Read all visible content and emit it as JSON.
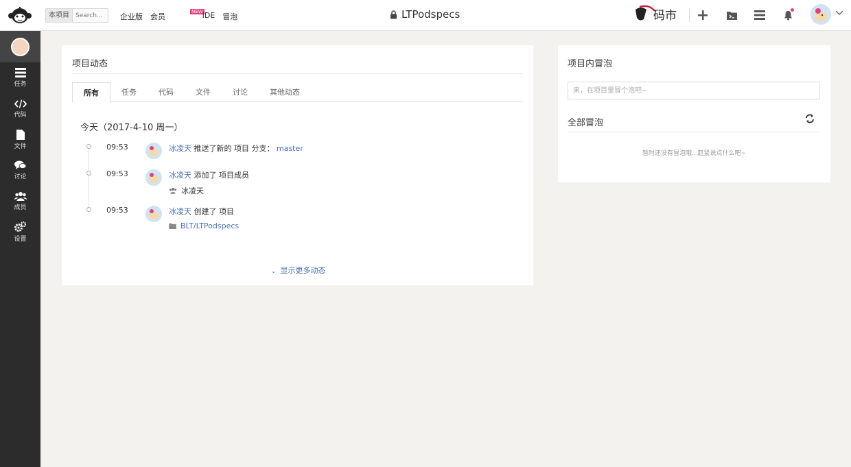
{
  "topbar": {
    "search_scope": "本项目",
    "search_placeholder": "Search...",
    "nav": [
      "企业版",
      "会员",
      "IDE",
      "冒泡"
    ],
    "new_badge": "NEW",
    "project_title": "LTPodspecs",
    "market_logo_text": "码市"
  },
  "sidebar": {
    "items": [
      {
        "label": "任务",
        "icon": "tasks-icon"
      },
      {
        "label": "代码",
        "icon": "code-icon"
      },
      {
        "label": "文件",
        "icon": "file-icon"
      },
      {
        "label": "讨论",
        "icon": "discussion-icon"
      },
      {
        "label": "成员",
        "icon": "members-icon"
      },
      {
        "label": "设置",
        "icon": "settings-icon"
      }
    ]
  },
  "activity": {
    "heading": "项目动态",
    "tabs": [
      "所有",
      "任务",
      "代码",
      "文件",
      "讨论",
      "其他动态"
    ],
    "active_tab": "所有",
    "day_label": "今天（2017-4-10 周一）",
    "events": [
      {
        "time": "09:53",
        "user": "冰凌天",
        "action": "推送了新的 项目 分支：",
        "target": "master"
      },
      {
        "time": "09:53",
        "user": "冰凌天",
        "action": "添加了 项目成员",
        "sub": "冰凌天"
      },
      {
        "time": "09:53",
        "user": "冰凌天",
        "action": "创建了 项目",
        "sub": "BLT/LTPodspecs"
      }
    ],
    "show_more": "显示更多动态"
  },
  "bubbles": {
    "heading": "项目内冒泡",
    "input_placeholder": "来，在项目里冒个泡吧~",
    "all_heading": "全部冒泡",
    "empty_text": "暂时还没有冒泡哦...赶紧说点什么吧~"
  },
  "colors": {
    "link": "#4a6fb5",
    "sidebar_bg": "#2c2c2c",
    "badge": "#e3407a",
    "page_bg": "#f3f2ef"
  }
}
